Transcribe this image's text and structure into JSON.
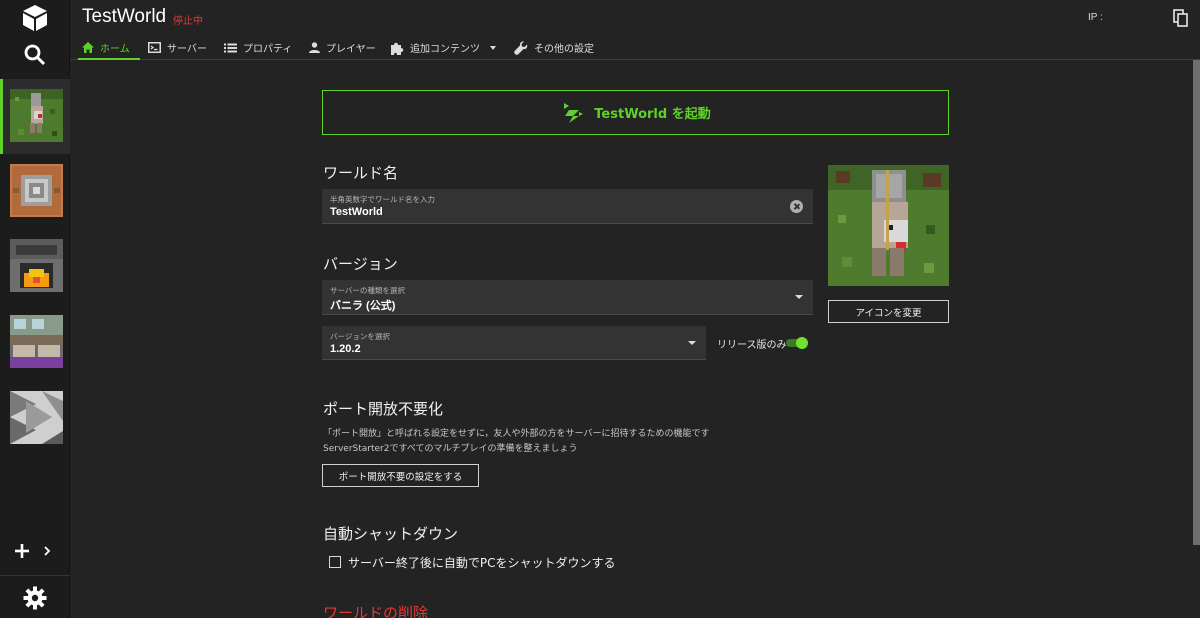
{
  "header": {
    "title": "TestWorld",
    "status": "停止中",
    "ip_label": "IP :"
  },
  "tabs": [
    {
      "label": "ホーム",
      "icon": "home-icon",
      "active": true
    },
    {
      "label": "サーバー",
      "icon": "terminal-icon"
    },
    {
      "label": "プロパティ",
      "icon": "list-icon"
    },
    {
      "label": "プレイヤー",
      "icon": "person-icon"
    },
    {
      "label": "追加コンテンツ",
      "icon": "puzzle-icon",
      "has_dropdown": true
    },
    {
      "label": "その他の設定",
      "icon": "wrench-icon"
    }
  ],
  "sidebar": {
    "worlds": [
      {
        "name": "world-1",
        "active": true
      },
      {
        "name": "world-2"
      },
      {
        "name": "world-3"
      },
      {
        "name": "world-4"
      },
      {
        "name": "world-5"
      }
    ]
  },
  "main": {
    "launch_label": "TestWorld を起動",
    "world_name": {
      "heading": "ワールド名",
      "field_label": "半角英数字でワールド名を入力",
      "value": "TestWorld"
    },
    "icon_change_label": "アイコンを変更",
    "version": {
      "heading": "バージョン",
      "server_type_label": "サーバーの種類を選択",
      "server_type_value": "バニラ (公式)",
      "version_label": "バージョンを選択",
      "version_value": "1.20.2",
      "release_only_label": "リリース版のみ",
      "release_only_on": true
    },
    "port": {
      "heading": "ポート開放不要化",
      "desc_line1": "「ポート開放」と呼ばれる設定をせずに，友人や外部の方をサーバーに招待するための機能です",
      "desc_line2": "ServerStarter2ですべてのマルチプレイの準備を整えましょう",
      "button_label": "ポート開放不要の設定をする"
    },
    "shutdown": {
      "heading": "自動シャットダウン",
      "checkbox_label": "サーバー終了後に自動でPCをシャットダウンする",
      "checked": false
    },
    "delete_heading": "ワールドの削除"
  },
  "colors": {
    "accent": "#5fd12a",
    "danger": "#e53935",
    "background": "#232323",
    "field": "#333333"
  }
}
